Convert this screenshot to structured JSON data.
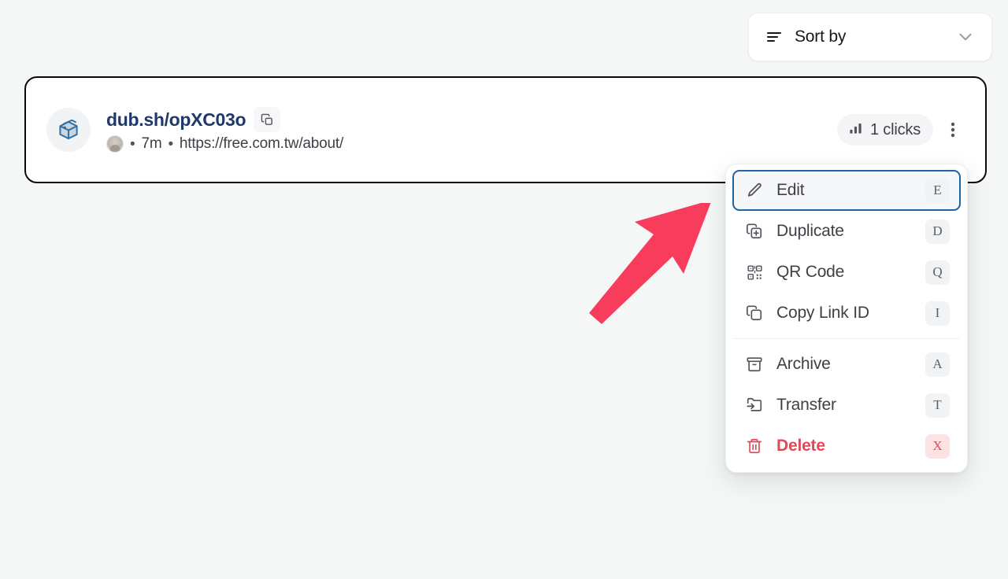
{
  "theme": {
    "page_background": "#f4f7f6",
    "card_border": "#0a0a0a",
    "link_color": "#1f3a68",
    "focus_ring": "#1f63a8",
    "danger": "#e04a58",
    "arrow_color": "#f83d5c"
  },
  "toolbar": {
    "sort_by_label": "Sort by",
    "sort_icon": "sort-lines-icon",
    "chevron_icon": "chevron-down-icon"
  },
  "link_card": {
    "favicon_icon": "package-box-icon",
    "short_url": "dub.sh/opXC03o",
    "copy_icon": "copy-icon",
    "avatar_icon": "user-avatar",
    "separator": "•",
    "age": "7m",
    "destination_url": "https://free.com.tw/about/",
    "clicks_icon": "bar-chart-icon",
    "clicks_label": "1 clicks",
    "kebab_icon": "more-vertical-icon"
  },
  "annotation": {
    "arrow_icon": "pointer-arrow-up-right"
  },
  "context_menu": {
    "groups": [
      {
        "items": [
          {
            "label": "Edit",
            "shortcut": "E",
            "icon": "pencil-icon",
            "focused": true,
            "danger": false
          },
          {
            "label": "Duplicate",
            "shortcut": "D",
            "icon": "duplicate-icon",
            "focused": false,
            "danger": false
          },
          {
            "label": "QR Code",
            "shortcut": "Q",
            "icon": "qr-code-icon",
            "focused": false,
            "danger": false
          },
          {
            "label": "Copy Link ID",
            "shortcut": "I",
            "icon": "copy-icon",
            "focused": false,
            "danger": false
          }
        ]
      },
      {
        "items": [
          {
            "label": "Archive",
            "shortcut": "A",
            "icon": "archive-icon",
            "focused": false,
            "danger": false
          },
          {
            "label": "Transfer",
            "shortcut": "T",
            "icon": "transfer-icon",
            "focused": false,
            "danger": false
          },
          {
            "label": "Delete",
            "shortcut": "X",
            "icon": "trash-icon",
            "focused": false,
            "danger": true
          }
        ]
      }
    ]
  }
}
